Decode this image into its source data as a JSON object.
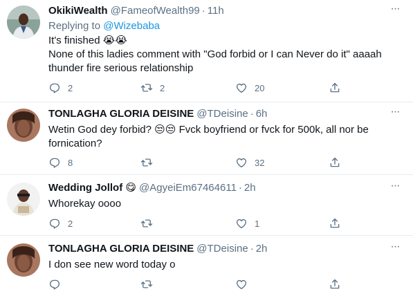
{
  "tweets": [
    {
      "name": "OkikiWealth",
      "handle": "@FameofWealth99",
      "time": "11h",
      "replying_prefix": "Replying to",
      "replying_to": "@Wizebaba",
      "lines": [
        "It's finished 😭😭",
        "None of this ladies comment with \"God forbid or I can Never do it\" aaaah",
        "thunder fire serious relationship"
      ],
      "replies": "2",
      "retweets": "2",
      "likes": "20"
    },
    {
      "name": "TONLAGHA GLORIA DEISINE",
      "handle": "@TDeisine",
      "time": "6h",
      "lines": [
        "Wetin God dey forbid? 😒😒 Fvck boyfriend or fvck for 500k, all nor be",
        "fornication?"
      ],
      "replies": "8",
      "retweets": "",
      "likes": "32"
    },
    {
      "name": "Wedding Jollof 😋",
      "handle": "@AgyeiEm67464611",
      "time": "2h",
      "lines": [
        "Whorekay oooo"
      ],
      "replies": "2",
      "retweets": "",
      "likes": "1"
    },
    {
      "name": "TONLAGHA GLORIA DEISINE",
      "handle": "@TDeisine",
      "time": "2h",
      "lines": [
        "I don see new word today o"
      ],
      "replies": "",
      "retweets": "",
      "likes": ""
    }
  ],
  "separator": "·",
  "icons": {
    "reply": "reply-icon",
    "retweet": "retweet-icon",
    "like": "like-icon",
    "share": "share-icon",
    "more": "more-options-icon"
  },
  "colors": {
    "text": "#0f1419",
    "secondary": "#5b7083",
    "link": "#1b95e0",
    "divider": "#e6ecf0"
  }
}
